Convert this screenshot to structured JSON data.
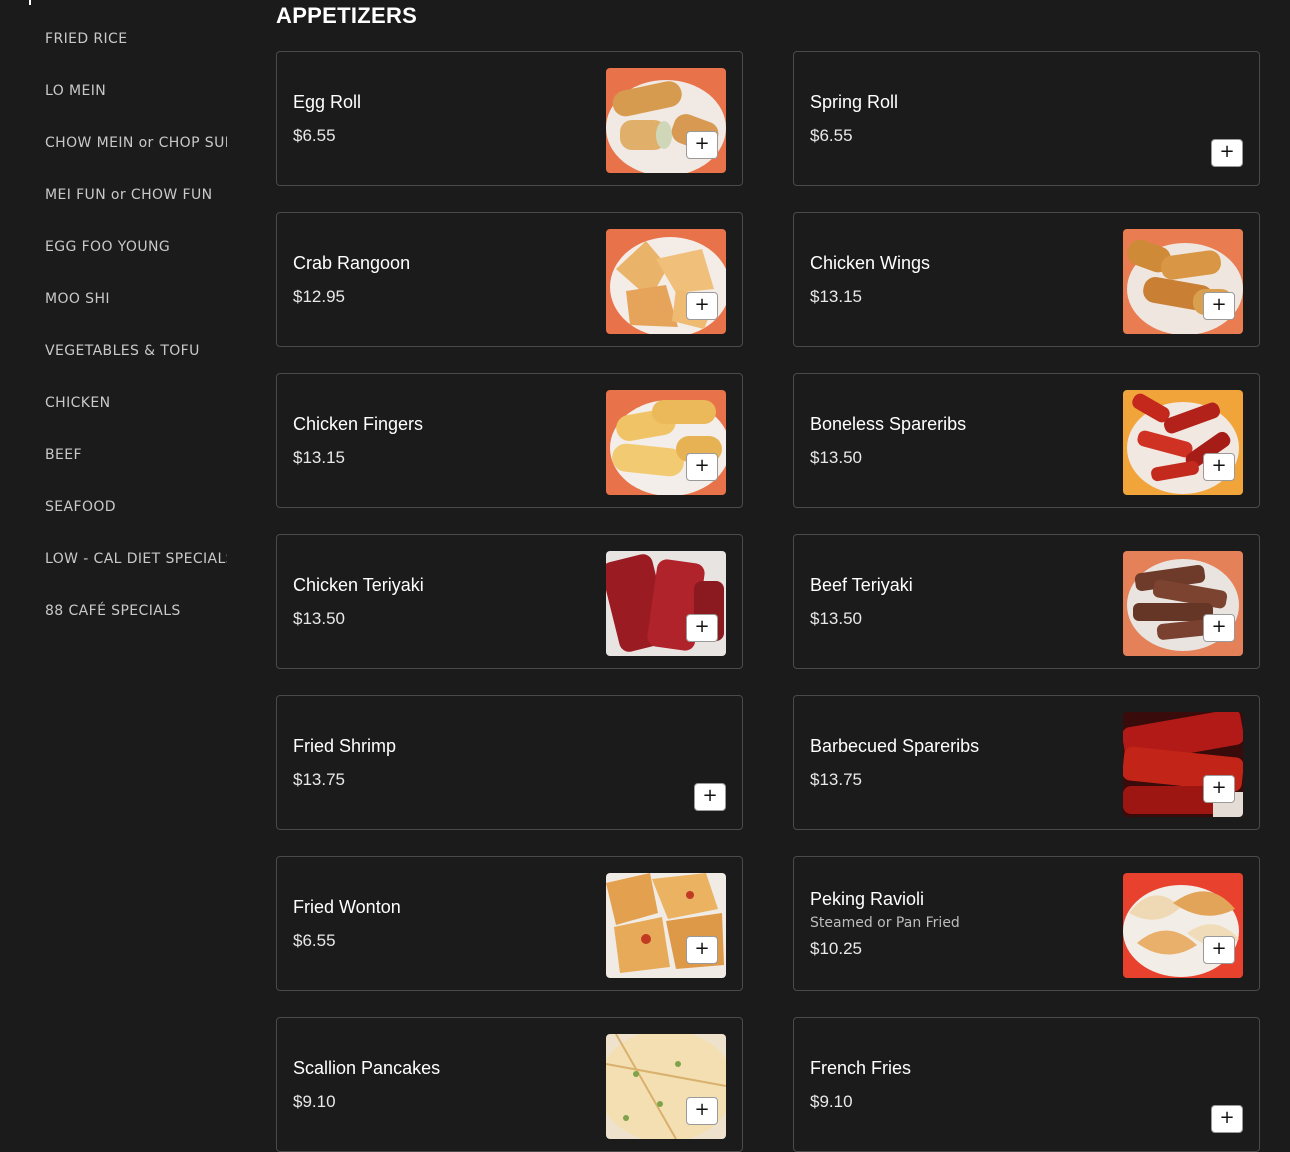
{
  "sidebar": {
    "items": [
      {
        "label": "FRIED RICE"
      },
      {
        "label": "LO MEIN"
      },
      {
        "label": "CHOW MEIN or CHOP SUEY"
      },
      {
        "label": "MEI FUN or CHOW FUN"
      },
      {
        "label": "EGG FOO YOUNG"
      },
      {
        "label": "MOO SHI"
      },
      {
        "label": "VEGETABLES & TOFU"
      },
      {
        "label": "CHICKEN"
      },
      {
        "label": "BEEF"
      },
      {
        "label": "SEAFOOD"
      },
      {
        "label": "LOW - CAL DIET SPECIALS"
      },
      {
        "label": "88 CAFÉ SPECIALS"
      }
    ]
  },
  "section": {
    "title": "APPETIZERS"
  },
  "add_button_label": "+",
  "menu_items": [
    {
      "name": "Egg Roll",
      "price": "$6.55",
      "has_photo": true,
      "photo_icon": "egg-roll-photo"
    },
    {
      "name": "Spring Roll",
      "price": "$6.55",
      "has_photo": false
    },
    {
      "name": "Crab Rangoon",
      "price": "$12.95",
      "has_photo": true,
      "photo_icon": "crab-rangoon-photo"
    },
    {
      "name": "Chicken Wings",
      "price": "$13.15",
      "has_photo": true,
      "photo_icon": "chicken-wings-photo"
    },
    {
      "name": "Chicken Fingers",
      "price": "$13.15",
      "has_photo": true,
      "photo_icon": "chicken-fingers-photo"
    },
    {
      "name": "Boneless Spareribs",
      "price": "$13.50",
      "has_photo": true,
      "photo_icon": "boneless-spareribs-photo"
    },
    {
      "name": "Chicken Teriyaki",
      "price": "$13.50",
      "has_photo": true,
      "photo_icon": "chicken-teriyaki-photo"
    },
    {
      "name": "Beef Teriyaki",
      "price": "$13.50",
      "has_photo": true,
      "photo_icon": "beef-teriyaki-photo"
    },
    {
      "name": "Fried Shrimp",
      "price": "$13.75",
      "has_photo": false
    },
    {
      "name": "Barbecued Spareribs",
      "price": "$13.75",
      "has_photo": true,
      "photo_icon": "barbecued-spareribs-photo"
    },
    {
      "name": "Fried Wonton",
      "price": "$6.55",
      "has_photo": true,
      "photo_icon": "fried-wonton-photo"
    },
    {
      "name": "Peking Ravioli",
      "description": "Steamed or Pan Fried",
      "price": "$10.25",
      "has_photo": true,
      "photo_icon": "peking-ravioli-photo"
    },
    {
      "name": "Scallion Pancakes",
      "price": "$9.10",
      "has_photo": true,
      "photo_icon": "scallion-pancakes-photo"
    },
    {
      "name": "French Fries",
      "price": "$9.10",
      "has_photo": false
    }
  ],
  "colors": {
    "background": "#1b1b1c",
    "card_border": "#4a4a4c",
    "text": "#ffffff",
    "muted_text": "#c9c9c9"
  }
}
